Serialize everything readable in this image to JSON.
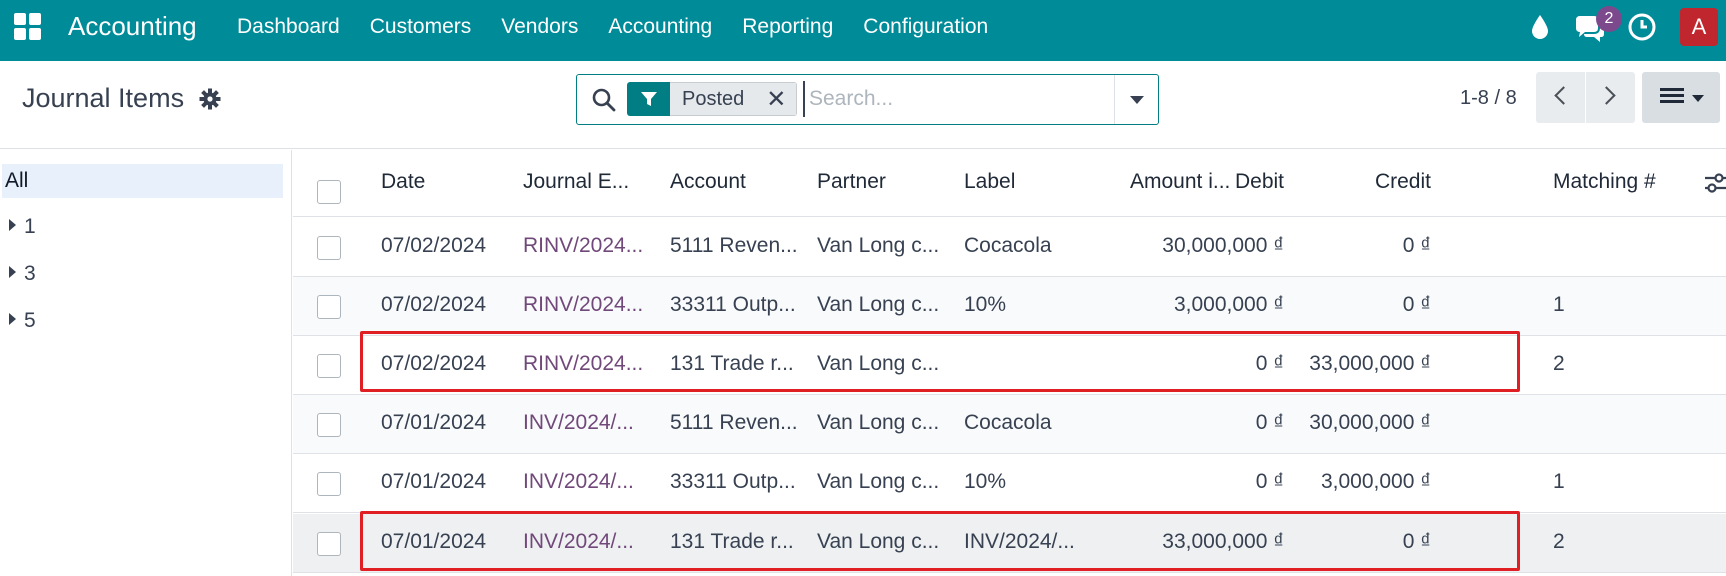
{
  "topnav": {
    "brand": "Accounting",
    "menu": [
      "Dashboard",
      "Customers",
      "Vendors",
      "Accounting",
      "Reporting",
      "Configuration"
    ],
    "chat_badge": "2",
    "avatar_letter": "A",
    "icons": [
      "apps-icon",
      "drop-icon",
      "chat-icon",
      "clock-icon"
    ]
  },
  "control_panel": {
    "title": "Journal Items",
    "search": {
      "facet_label": "Posted",
      "facet_close": "✕",
      "placeholder": "Search..."
    },
    "pager": "1-8 / 8"
  },
  "left_panel": {
    "all_label": "All",
    "groups": [
      "1",
      "3",
      "5"
    ]
  },
  "table": {
    "headers": {
      "date": "Date",
      "journal_entry": "Journal E...",
      "account": "Account",
      "partner": "Partner",
      "label": "Label",
      "amount_currency": "Amount i...",
      "debit": "Debit",
      "credit": "Credit",
      "matching": "Matching #"
    },
    "rows": [
      {
        "date": "07/02/2024",
        "entry": "RINV/2024...",
        "account": "5111 Reven...",
        "partner": "Van Long c...",
        "label": "Cocacola",
        "amount": "",
        "debit": "30,000,000 ₫",
        "credit": "0 ₫",
        "matching": ""
      },
      {
        "date": "07/02/2024",
        "entry": "RINV/2024...",
        "account": "33311 Outp...",
        "partner": "Van Long c...",
        "label": "10%",
        "amount": "",
        "debit": "3,000,000 ₫",
        "credit": "0 ₫",
        "matching": "1"
      },
      {
        "date": "07/02/2024",
        "entry": "RINV/2024...",
        "account": "131 Trade r...",
        "partner": "Van Long c...",
        "label": "",
        "amount": "",
        "debit": "0 ₫",
        "credit": "33,000,000 ₫",
        "matching": "2"
      },
      {
        "date": "07/01/2024",
        "entry": "INV/2024/...",
        "account": "5111 Reven...",
        "partner": "Van Long c...",
        "label": "Cocacola",
        "amount": "",
        "debit": "0 ₫",
        "credit": "30,000,000 ₫",
        "matching": ""
      },
      {
        "date": "07/01/2024",
        "entry": "INV/2024/...",
        "account": "33311 Outp...",
        "partner": "Van Long c...",
        "label": "10%",
        "amount": "",
        "debit": "0 ₫",
        "credit": "3,000,000 ₫",
        "matching": "1"
      },
      {
        "date": "07/01/2024",
        "entry": "INV/2024/...",
        "account": "131 Trade r...",
        "partner": "Van Long c...",
        "label": "INV/2024/...",
        "amount": "",
        "debit": "33,000,000 ₫",
        "credit": "0 ₫",
        "matching": "2"
      }
    ]
  },
  "colors": {
    "navbar": "#008b99",
    "primary": "#017e84",
    "link": "#71487a",
    "highlight": "#e01f25",
    "badge": "#7c4a8c",
    "avatar": "#c0262d"
  }
}
